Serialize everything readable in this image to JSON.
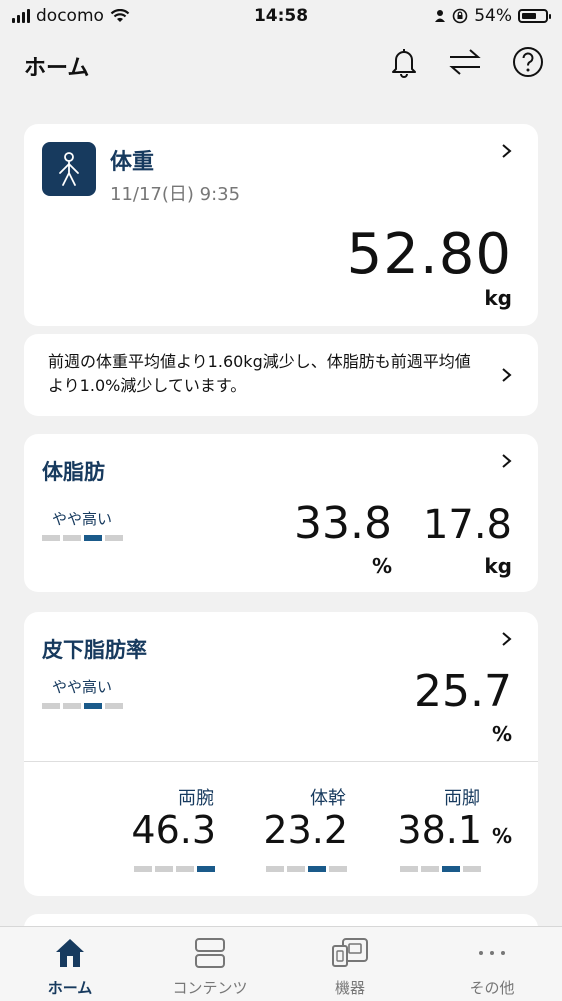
{
  "status_bar": {
    "carrier": "docomo",
    "time": "14:58",
    "battery": "54%"
  },
  "header": {
    "title": "ホーム"
  },
  "weight": {
    "title": "体重",
    "date": "11/17(日) 9:35",
    "value": "52.80",
    "unit": "kg"
  },
  "message": {
    "text": "前週の体重平均値より1.60kg減少し、体脂肪も前週平均値より1.0%減少しています。"
  },
  "body_fat": {
    "title": "体脂肪",
    "level": "やや高い",
    "level_index": 3,
    "level_count": 4,
    "percent": "33.8",
    "percent_unit": "%",
    "mass": "17.8",
    "mass_unit": "kg"
  },
  "subcutaneous": {
    "title": "皮下脂肪率",
    "level": "やや高い",
    "level_index": 3,
    "value": "25.7",
    "unit": "%",
    "segments": [
      {
        "label": "両腕",
        "value": "46.3",
        "level_index": 4
      },
      {
        "label": "体幹",
        "value": "23.2",
        "level_index": 3
      },
      {
        "label": "両脚",
        "value": "38.1",
        "level_index": 3
      }
    ],
    "segment_unit": "%"
  },
  "tabs": [
    {
      "label": "ホーム",
      "icon": "home-icon",
      "active": true
    },
    {
      "label": "コンテンツ",
      "icon": "contents-icon",
      "active": false
    },
    {
      "label": "機器",
      "icon": "devices-icon",
      "active": false
    },
    {
      "label": "その他",
      "icon": "more-icon",
      "active": false
    }
  ],
  "colors": {
    "accent": "#173a5e",
    "level_on": "#1a5a8a",
    "level_off": "#cfcfcf",
    "background": "#f1f1f1"
  }
}
